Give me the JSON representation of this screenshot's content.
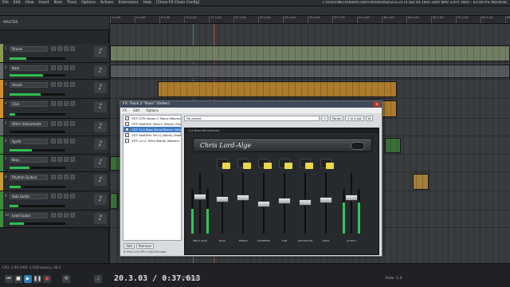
{
  "menu": {
    "items": [
      "File",
      "Edit",
      "View",
      "Insert",
      "Item",
      "Track",
      "Options",
      "Actions",
      "Extensions",
      "Help"
    ],
    "fx_tab": "[Close FX Chain Config]",
    "path": "C:\\Users\\NECRODERS.DRATOR\\Desktop\\223.22 (4 GB) 44.1kHz 32bit WAV 2/2ch 16Hz – 43.587ms WaveOut"
  },
  "master": {
    "label": "MASTER"
  },
  "tracks": [
    {
      "num": "1",
      "name": "Drums",
      "color": "#8a9a5a"
    },
    {
      "num": "2",
      "name": "Bass",
      "color": "#6a6a6a"
    },
    {
      "num": "3",
      "name": "Vocals",
      "color": "#d09030"
    },
    {
      "num": "4",
      "name": "Click",
      "color": "#d09030"
    },
    {
      "num": "5",
      "name": "Other Instruments",
      "color": "#666"
    },
    {
      "num": "6",
      "name": "Synth",
      "color": "#3e8a3e"
    },
    {
      "num": "7",
      "name": "Keys",
      "color": "#3e8a3e"
    },
    {
      "num": "8",
      "name": "Rhythm Guitars",
      "color": "#c49a3a"
    },
    {
      "num": "9",
      "name": "Solo Guitar",
      "color": "#3e8a3e"
    },
    {
      "num": "10",
      "name": "Lead Guitar",
      "color": "#3e8a3e"
    }
  ],
  "timeline": {
    "ticks": [
      "1.1.00",
      "5.1.00",
      "9.1.00",
      "13.1.00",
      "17.1.00",
      "21.1.00",
      "25.1.00",
      "29.1.00",
      "33.1.00",
      "37.1.00",
      "41.1.00",
      "45.1.00",
      "49.1.00",
      "53.1.00",
      "57.1.00",
      "61.1.00",
      "65.1.00"
    ]
  },
  "fx_window": {
    "title": "FX: Track 2 \"Bass\" (folder)",
    "menu": [
      "FX",
      "Edit",
      "Options"
    ],
    "chain": [
      {
        "label": "VST: GTR Stomp 2 Mono (Waves)",
        "checked": true,
        "selected": false
      },
      {
        "label": "VST: FabFilter Saturn (Mono) (FabFilter)",
        "checked": true,
        "selected": false
      },
      {
        "label": "VST: CLA Bass Mono/Stereo (Waves)",
        "checked": true,
        "selected": true
      },
      {
        "label": "VST: FabFilter Pro-Q (Mono) (FabFilter)",
        "checked": true,
        "selected": false
      },
      {
        "label": "VST: L2 LL Ultra Stereo (Waves)",
        "checked": false,
        "selected": false
      }
    ],
    "add_label": "Add",
    "remove_label": "Remove",
    "cpu_text": "0.5%/1.1% CPU 1/3/1024 spls",
    "preset": {
      "value": "No preset",
      "buttons": [
        "+",
        "Param",
        "1 in 2 out",
        "UI"
      ]
    },
    "plugin": {
      "header": "CLA Bass Mono/Stereo",
      "signature": "Chris Lord-Alge",
      "channels": [
        {
          "label": "INPUT GAIN",
          "level": 0.55,
          "knob": 0.62
        },
        {
          "label": "BASS",
          "level": 0,
          "knob": 0.58
        },
        {
          "label": "TREBLE",
          "level": 0,
          "knob": 0.6
        },
        {
          "label": "COMPRESS",
          "level": 0,
          "knob": 0.48
        },
        {
          "label": "SUB",
          "level": 0,
          "knob": 0.55
        },
        {
          "label": "DISTORTION",
          "level": 0,
          "knob": 0.52
        },
        {
          "label": "PITCH",
          "level": 0,
          "knob": 0.56
        },
        {
          "label": "OUTPUT",
          "level": 0.7,
          "knob": 0.6
        }
      ]
    }
  },
  "transport": {
    "time": "20.3.03 / 0:37.613",
    "state": "[Playing]",
    "cpu": "CPU: 1.9%  RAM: 3.5GB  latency: 38.0",
    "rate_label": "Rate:",
    "rate_value": "1.0"
  }
}
